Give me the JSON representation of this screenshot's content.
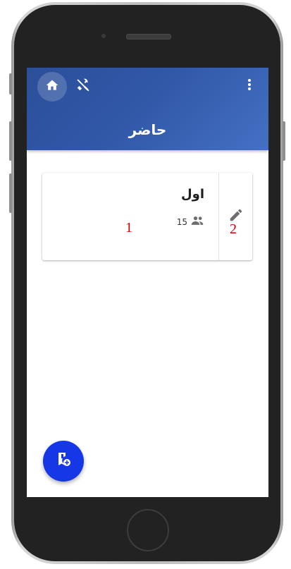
{
  "appbar": {
    "title": "حاضر",
    "icons": {
      "home": "home-icon",
      "tool": "tools-off-icon",
      "menu": "more-vertical-icon"
    }
  },
  "groups": [
    {
      "title": "اول",
      "member_count": "15",
      "icons": {
        "members": "people-icon",
        "edit": "pencil-icon"
      }
    }
  ],
  "annotations": {
    "label_1": "1",
    "label_2": "2"
  },
  "fab": {
    "icon": "add-bookmark-icon"
  },
  "colors": {
    "appbar_start": "#2b4f9a",
    "appbar_end": "#4470c4",
    "fab": "#1537e6",
    "annotation": "#cc0000"
  }
}
